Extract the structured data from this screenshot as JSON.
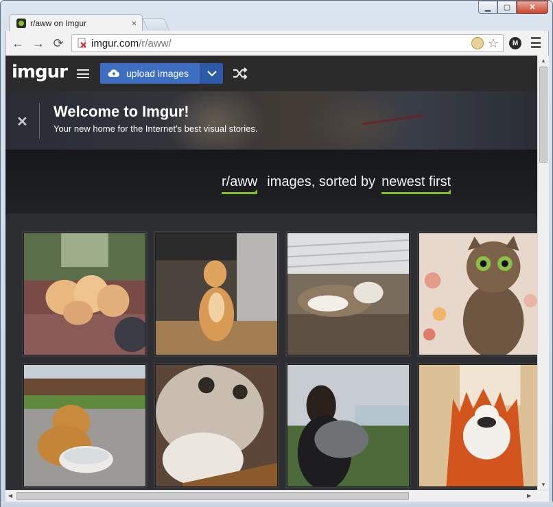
{
  "browser": {
    "tab_title": "r/aww on Imgur",
    "tab_close": "×",
    "url_host": "imgur.com",
    "url_path": "/r/aww/",
    "profile_initial": "M",
    "nav": {
      "back": "←",
      "forward": "→",
      "reload": "⟳"
    },
    "window_buttons": {
      "minimize": "▁",
      "maximize": "▢",
      "close": "✕"
    },
    "star": "☆"
  },
  "imgur": {
    "logo": "imgur",
    "upload_label": "upload images",
    "accent": "#85bf25",
    "upload_color": "#3e6ec2"
  },
  "banner": {
    "close": "✕",
    "title": "Welcome to Imgur!",
    "subtitle": "Your new home for the Internet's best visual stories."
  },
  "sort": {
    "subreddit": "r/aww",
    "middle": "images, sorted by",
    "order": "newest first"
  },
  "gallery": {
    "items": [
      {
        "subject": "baby chicks"
      },
      {
        "subject": "dog standing on hind legs"
      },
      {
        "subject": "husky lying outside"
      },
      {
        "subject": "wide-eyed cat"
      },
      {
        "subject": "golden retriever with water bowl"
      },
      {
        "subject": "cat close-up"
      },
      {
        "subject": "woman hugging dog"
      },
      {
        "subject": "cat on orange throne"
      }
    ]
  }
}
